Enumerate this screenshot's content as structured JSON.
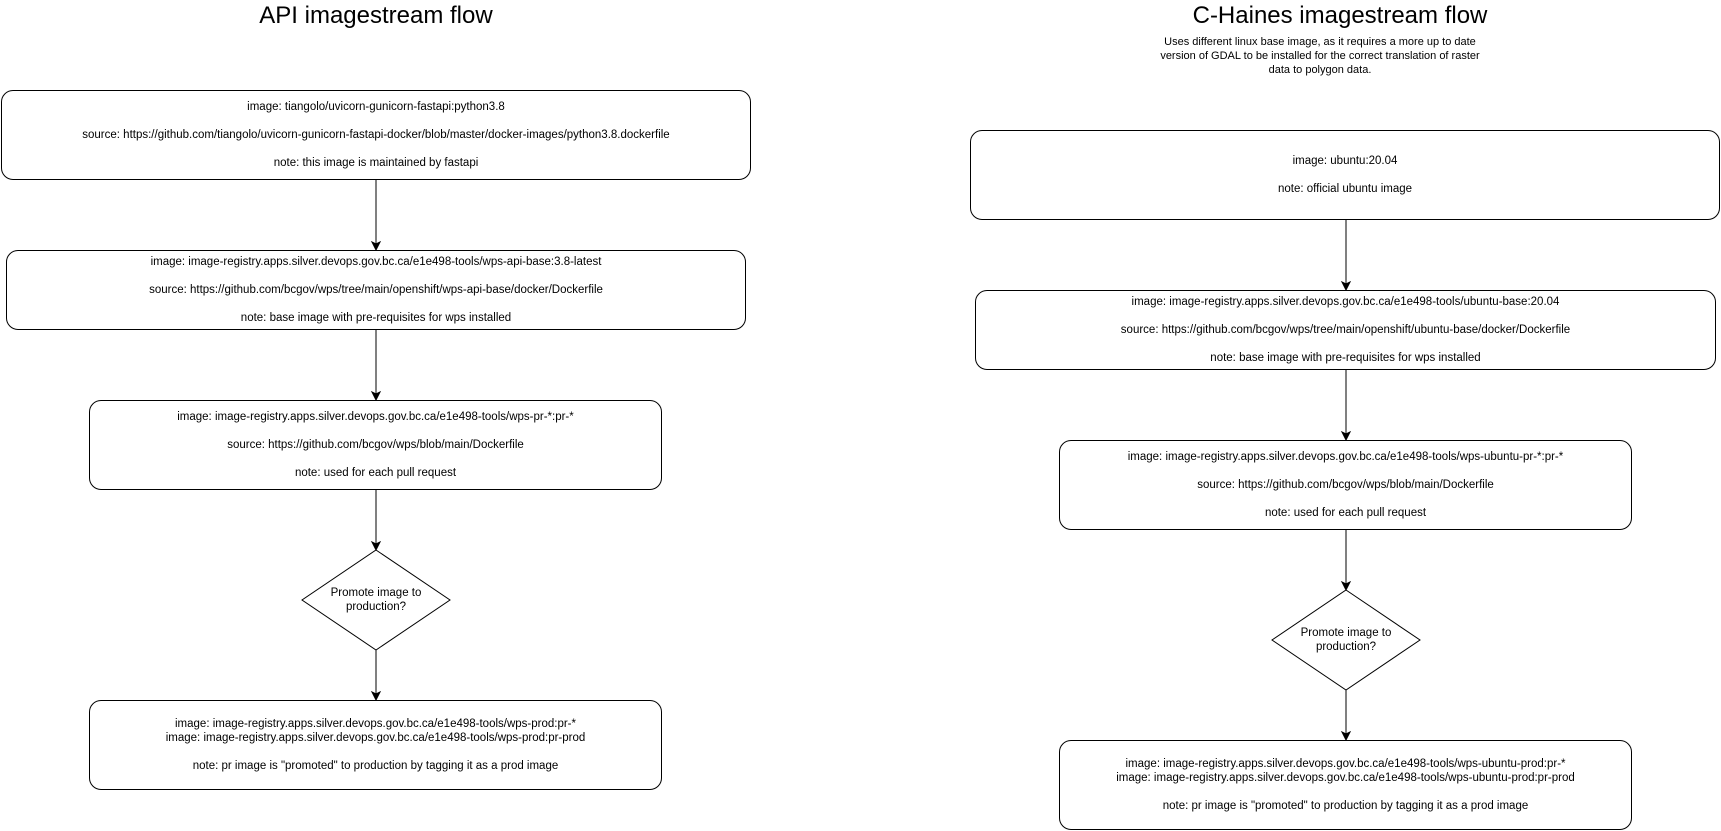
{
  "api": {
    "title": "API imagestream flow",
    "box1": {
      "image": "image: tiangolo/uvicorn-gunicorn-fastapi:python3.8",
      "source": "source: https://github.com/tiangolo/uvicorn-gunicorn-fastapi-docker/blob/master/docker-images/python3.8.dockerfile",
      "note": "note: this image is maintained by fastapi"
    },
    "box2": {
      "image": "image: image-registry.apps.silver.devops.gov.bc.ca/e1e498-tools/wps-api-base:3.8-latest",
      "source": "source: https://github.com/bcgov/wps/tree/main/openshift/wps-api-base/docker/Dockerfile",
      "note": "note: base image with pre-requisites for wps installed"
    },
    "box3": {
      "image": "image: image-registry.apps.silver.devops.gov.bc.ca/e1e498-tools/wps-pr-*:pr-*",
      "source": "source: https://github.com/bcgov/wps/blob/main/Dockerfile",
      "note": "note: used for each pull request"
    },
    "decision": {
      "line1": "Promote image to",
      "line2": "production?"
    },
    "box4": {
      "image1": "image: image-registry.apps.silver.devops.gov.bc.ca/e1e498-tools/wps-prod:pr-*",
      "image2": "image: image-registry.apps.silver.devops.gov.bc.ca/e1e498-tools/wps-prod:pr-prod",
      "note": "note: pr image is \"promoted\" to production by tagging it as a prod image"
    }
  },
  "chaines": {
    "title": "C-Haines imagestream flow",
    "subtitle": {
      "line1": "Uses different linux base image, as it requires a more up to date",
      "line2": "version of GDAL to be installed for the correct translation of raster",
      "line3": "data to polygon data."
    },
    "box1": {
      "image": "image: ubuntu:20.04",
      "note": "note: official ubuntu image"
    },
    "box2": {
      "image": "image: image-registry.apps.silver.devops.gov.bc.ca/e1e498-tools/ubuntu-base:20.04",
      "source": "source: https://github.com/bcgov/wps/tree/main/openshift/ubuntu-base/docker/Dockerfile",
      "note": "note: base image with pre-requisites for wps installed"
    },
    "box3": {
      "image": "image: image-registry.apps.silver.devops.gov.bc.ca/e1e498-tools/wps-ubuntu-pr-*:pr-*",
      "source": "source: https://github.com/bcgov/wps/blob/main/Dockerfile",
      "note": "note: used for each pull request"
    },
    "decision": {
      "line1": "Promote image to",
      "line2": "production?"
    },
    "box4": {
      "image1": "image: image-registry.apps.silver.devops.gov.bc.ca/e1e498-tools/wps-ubuntu-prod:pr-*",
      "image2": "image: image-registry.apps.silver.devops.gov.bc.ca/e1e498-tools/wps-ubuntu-prod:pr-prod",
      "note": "note: pr image is \"promoted\" to production by tagging it as a prod image"
    }
  }
}
